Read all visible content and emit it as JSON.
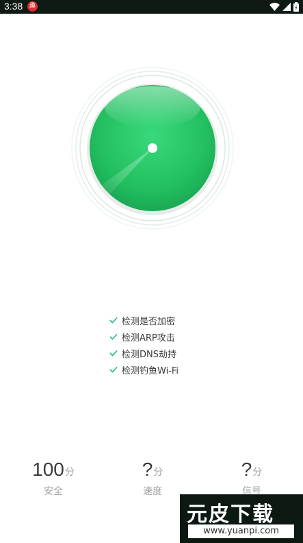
{
  "status_bar": {
    "time": "3:38",
    "app_icon_char": "趣"
  },
  "checks": [
    {
      "label": "检测是否加密"
    },
    {
      "label": "检测ARP攻击"
    },
    {
      "label": "检测DNS劫持"
    },
    {
      "label": "检测钓鱼Wi-Fi"
    }
  ],
  "scores": {
    "security": {
      "value": "100",
      "unit": "分",
      "label": "安全"
    },
    "speed": {
      "value": "?",
      "unit": "分",
      "label": "速度"
    },
    "signal": {
      "value": "?",
      "unit": "分",
      "label": "信号"
    }
  },
  "watermark": {
    "title": "元皮下载",
    "url": "www.yuanpi.com"
  },
  "colors": {
    "accent": "#2fcb6b",
    "check": "#1dbb73"
  }
}
